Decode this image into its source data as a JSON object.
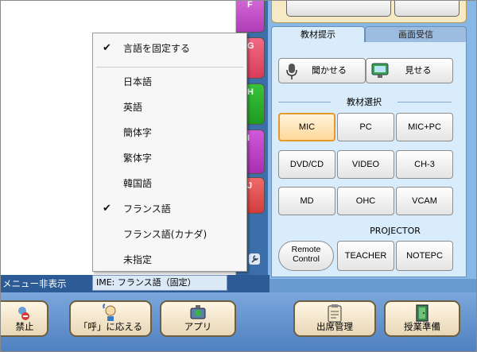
{
  "side_tabs": [
    "F",
    "G",
    "H",
    "I",
    "J"
  ],
  "top_tabs": {
    "kyozai_teiji": "教材提示",
    "gamen_jushin": "画面受信"
  },
  "present_buttons": {
    "kikaseru": "聞かせる",
    "miseru": "見せる"
  },
  "section_kyozai": "教材選択",
  "source_buttons": [
    {
      "label": "MIC",
      "active": true
    },
    {
      "label": "PC",
      "active": false
    },
    {
      "label": "MIC+PC",
      "active": false
    },
    {
      "label": "DVD/CD",
      "active": false
    },
    {
      "label": "VIDEO",
      "active": false
    },
    {
      "label": "CH-3",
      "active": false
    },
    {
      "label": "MD",
      "active": false
    },
    {
      "label": "OHC",
      "active": false
    },
    {
      "label": "VCAM",
      "active": false
    }
  ],
  "section_projector": "PROJECTOR",
  "projector": {
    "remote_line1": "Remote",
    "remote_line2": "Control",
    "teacher": "TEACHER",
    "notepc": "NOTEPC"
  },
  "context_menu": {
    "items": [
      {
        "label": "言語を固定する",
        "checked": true
      },
      {
        "label": "日本語",
        "checked": false
      },
      {
        "label": "英語",
        "checked": false
      },
      {
        "label": "簡体字",
        "checked": false
      },
      {
        "label": "繁体字",
        "checked": false
      },
      {
        "label": "韓国語",
        "checked": false
      },
      {
        "label": "フランス語",
        "checked": true
      },
      {
        "label": "フランス語(カナダ)",
        "checked": false
      },
      {
        "label": "未指定",
        "checked": false
      }
    ],
    "check_glyph": "✔"
  },
  "status": {
    "menu_hidden": "メニュー非表示",
    "ime": "IME: フランス語（固定）"
  },
  "bottom_toolbar": {
    "kinshi": "禁止",
    "yobi": "「呼」に応える",
    "apuri": "アプリ",
    "shukketsu": "出席管理",
    "jugyo": "授業準備"
  }
}
